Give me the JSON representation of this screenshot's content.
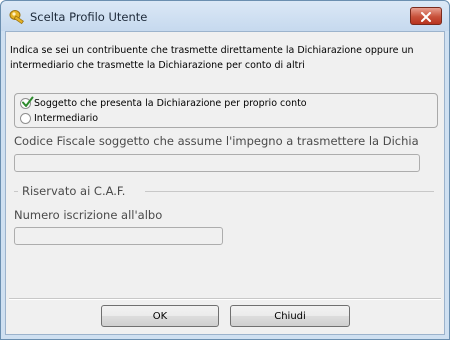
{
  "window": {
    "title": "Scelta Profilo Utente",
    "app_icon": "lock-key-icon",
    "close_icon": "close-icon"
  },
  "info": {
    "line1": "Indica se sei un contribuente che trasmette direttamente la Dichiarazione oppure un",
    "line2": "intermediario che trasmette la Dichiarazione per conto di altri"
  },
  "profile_options": [
    {
      "label": "Soggetto che presenta la Dichiarazione per proprio conto",
      "checked": true
    },
    {
      "label": "Intermediario",
      "checked": false
    }
  ],
  "codice_fiscale": {
    "label": "Codice Fiscale soggetto che assume l'impegno a trasmettere la Dichia",
    "value": ""
  },
  "caf_section": {
    "title": "Riservato ai C.A.F.",
    "albo_label": "Numero iscrizione all'albo",
    "albo_value": ""
  },
  "buttons": {
    "ok": "OK",
    "close": "Chiudi"
  },
  "colors": {
    "accent": "#c8513a",
    "check": "#2e8b2e"
  }
}
